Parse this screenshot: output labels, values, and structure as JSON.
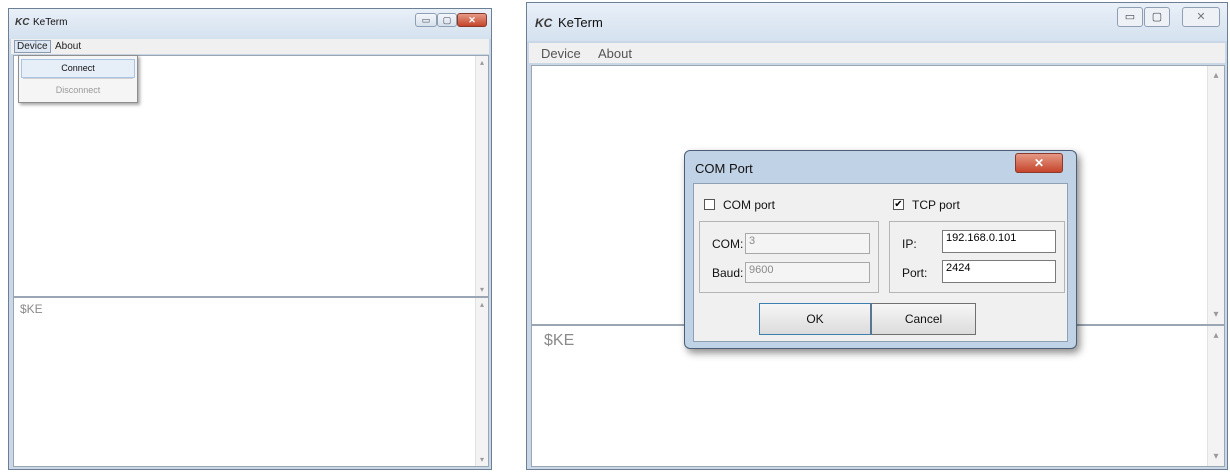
{
  "left_window": {
    "title": "KeTerm",
    "logo": "KC",
    "menu": [
      "Device",
      "About"
    ],
    "dropdown": {
      "items": [
        {
          "label": "Connect",
          "enabled": true
        },
        {
          "label": "Disconnect",
          "enabled": false
        }
      ]
    },
    "input_prompt": "$KE"
  },
  "right_window": {
    "title": "KeTerm",
    "logo": "KC",
    "menu": [
      "Device",
      "About"
    ],
    "input_prompt": "$KE",
    "dialog": {
      "title": "COM Port",
      "com_group": {
        "checkbox_label": "COM port",
        "checked": false,
        "com_label": "COM:",
        "com_value": "3",
        "baud_label": "Baud:",
        "baud_value": "9600"
      },
      "tcp_group": {
        "checkbox_label": "TCP port",
        "checked": true,
        "checkmark": "✔",
        "ip_label": "IP:",
        "ip_value": "192.168.0.101",
        "port_label": "Port:",
        "port_value": "2424"
      },
      "ok_label": "OK",
      "cancel_label": "Cancel"
    }
  },
  "icons": {
    "minimize": "▭",
    "maximize": "▢",
    "close": "✕",
    "up": "▴",
    "down": "▾"
  }
}
